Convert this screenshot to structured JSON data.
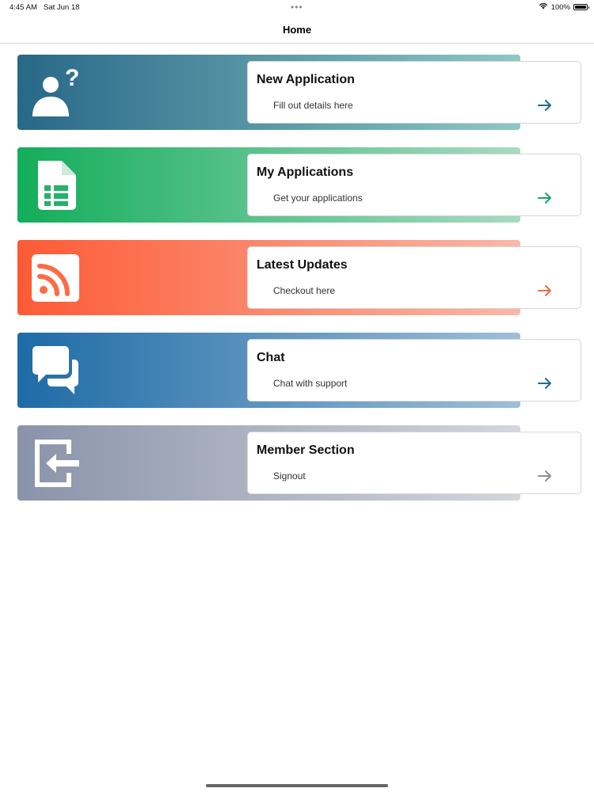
{
  "status_bar": {
    "time": "4:45 AM",
    "date": "Sat Jun 18",
    "battery": "100%",
    "icons": [
      "wifi-icon",
      "battery-icon"
    ]
  },
  "nav": {
    "title": "Home"
  },
  "menu": [
    {
      "title": "New Application",
      "subtitle": "Fill out details here",
      "icon": "user-question-icon",
      "gradient_from": "#286888",
      "gradient_to": "#8cc8c4",
      "accent": "#1e6d86"
    },
    {
      "title": "My Applications",
      "subtitle": "Get your applications",
      "icon": "spreadsheet-icon",
      "gradient_from": "#13ad5b",
      "gradient_to": "#a9dac2",
      "accent": "#17a463"
    },
    {
      "title": "Latest Updates",
      "subtitle": "Checkout here",
      "icon": "rss-feed-icon",
      "gradient_from": "#fd5a36",
      "gradient_to": "#f9b8a6",
      "accent": "#ee6a45"
    },
    {
      "title": "Chat",
      "subtitle": "Chat with support",
      "icon": "chat-bubbles-icon",
      "gradient_from": "#1e6ba6",
      "gradient_to": "#9ebfd8",
      "accent": "#1e6a9e"
    },
    {
      "title": "Member Section",
      "subtitle": "Signout",
      "icon": "signout-icon",
      "gradient_from": "#8a93aa",
      "gradient_to": "#d4d6dc",
      "accent": "#909090"
    }
  ]
}
